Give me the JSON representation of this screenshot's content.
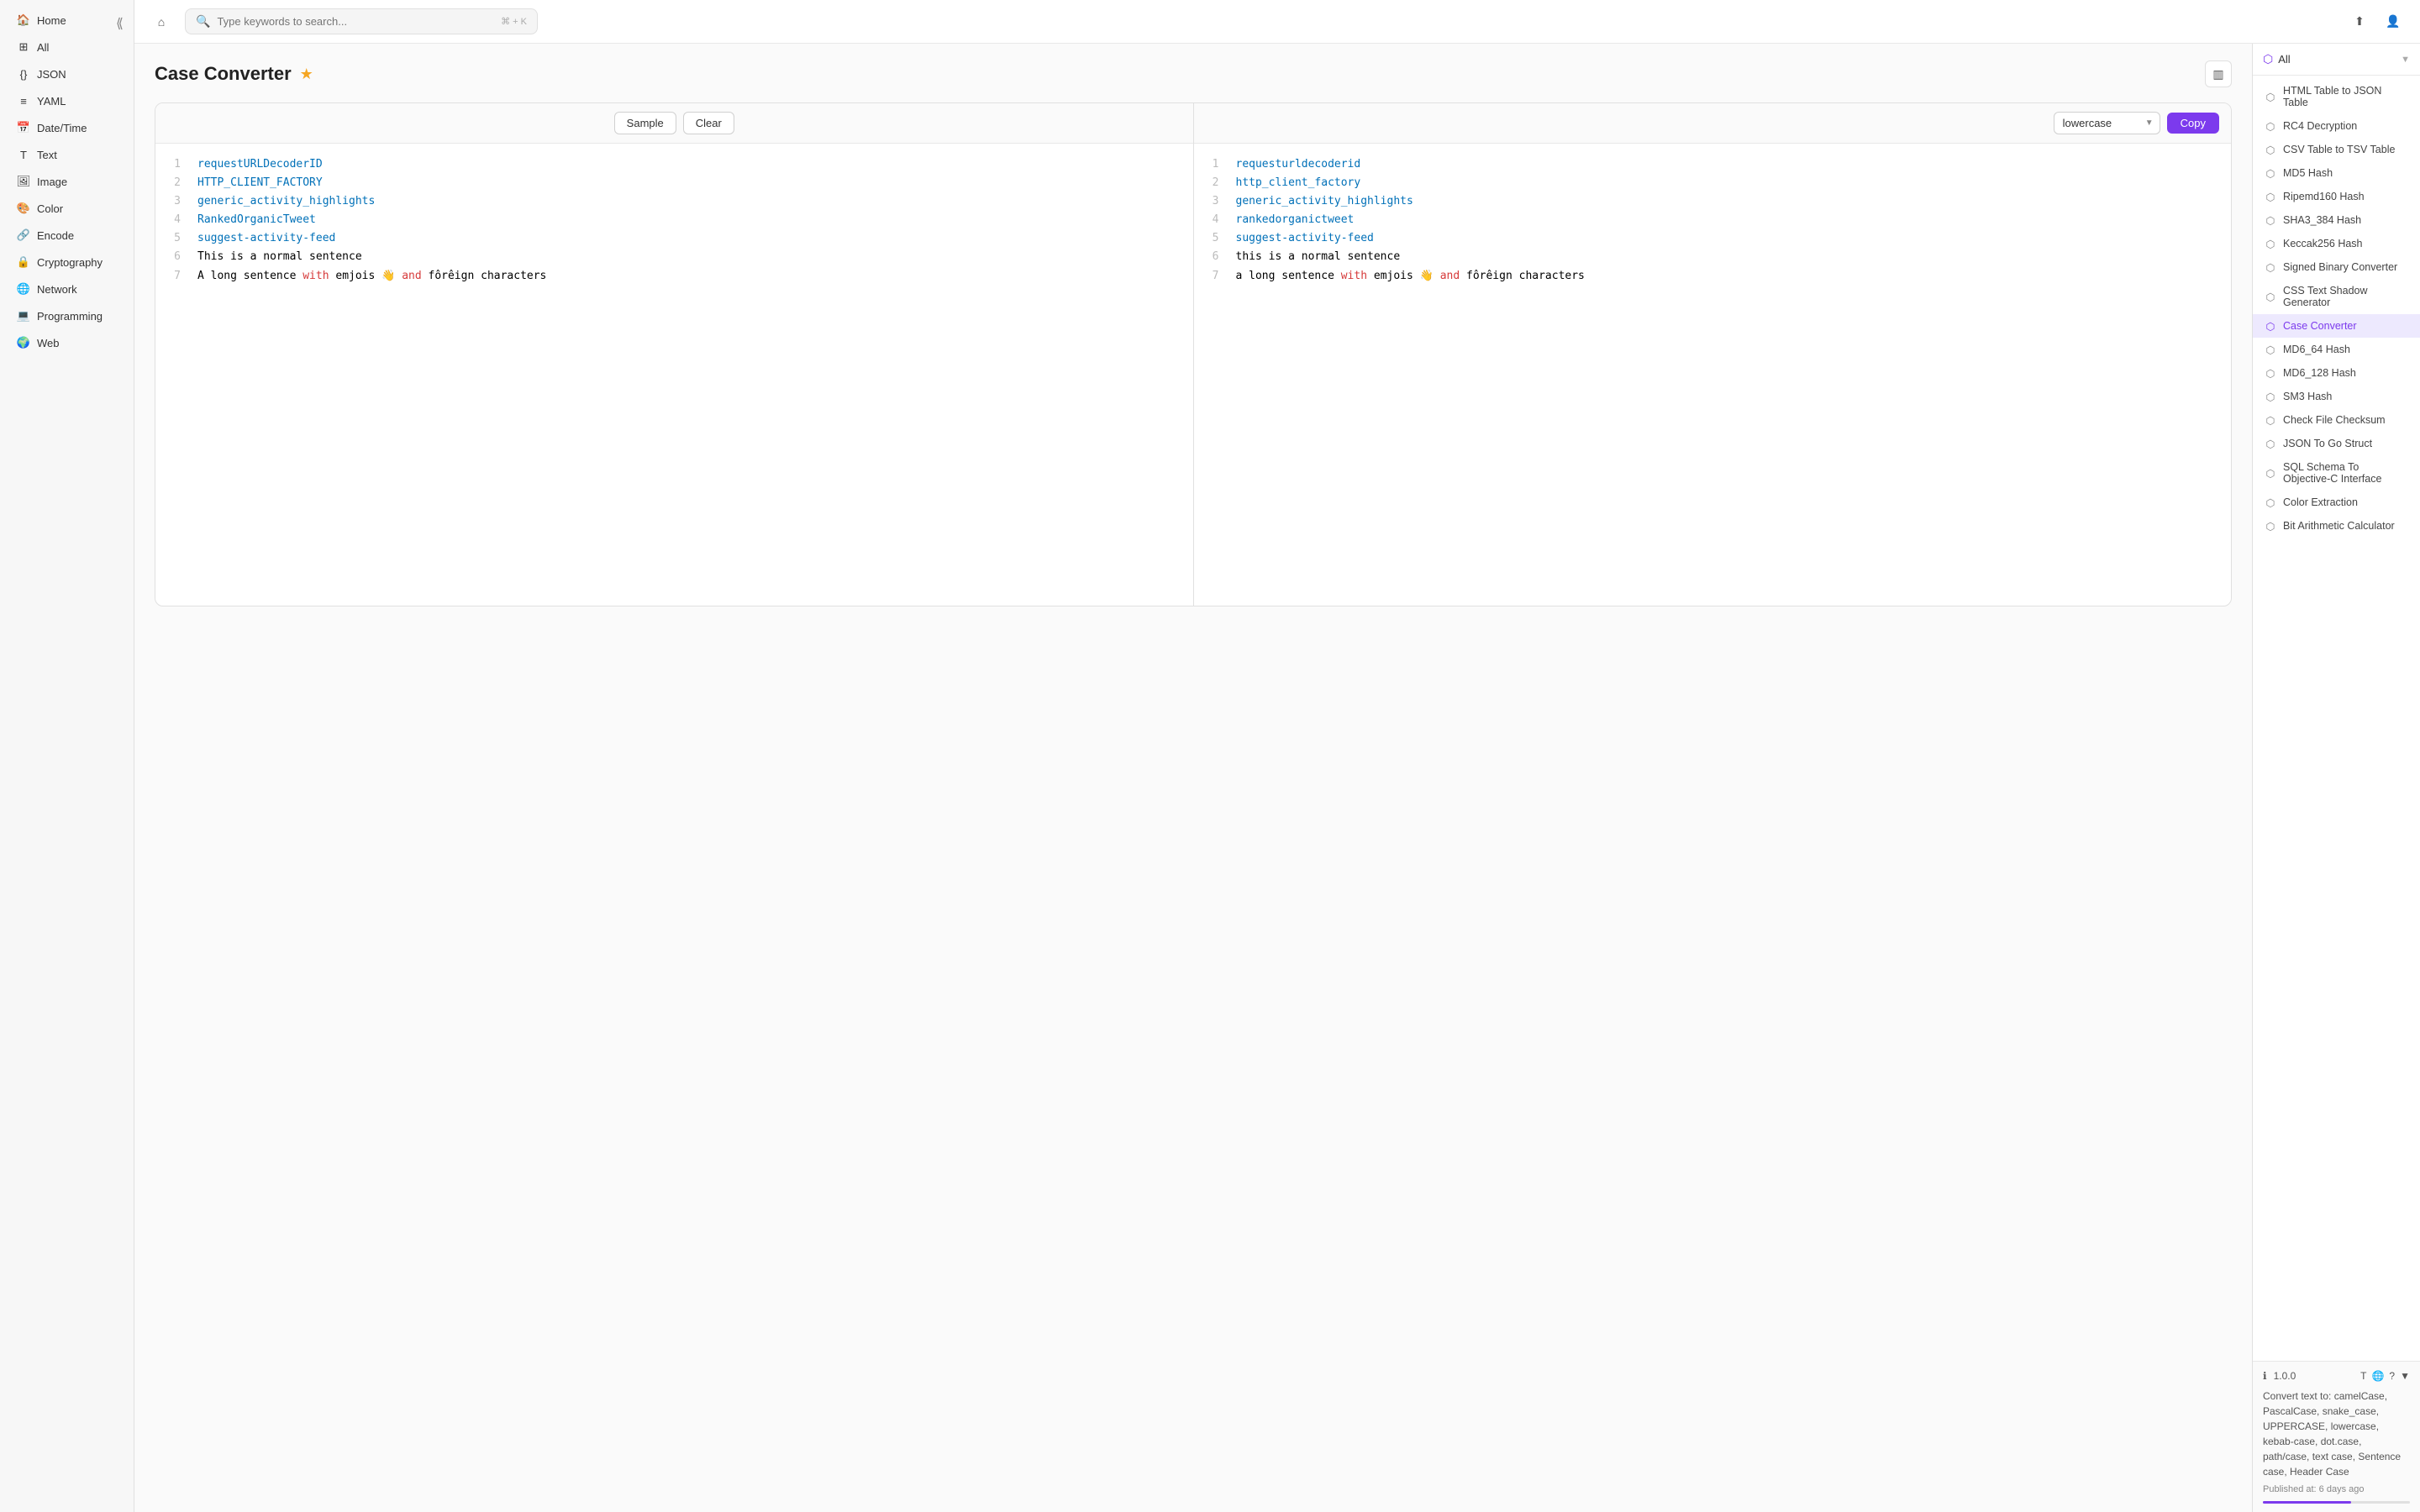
{
  "app": {
    "title": "Case Converter"
  },
  "topbar": {
    "search_placeholder": "Type keywords to search...",
    "shortcut": "⌘ + K"
  },
  "sidebar": {
    "items": [
      {
        "id": "home",
        "label": "Home",
        "icon": "🏠"
      },
      {
        "id": "all",
        "label": "All",
        "icon": "⊞"
      },
      {
        "id": "json",
        "label": "JSON",
        "icon": "{}"
      },
      {
        "id": "yaml",
        "label": "YAML",
        "icon": "≡"
      },
      {
        "id": "datetime",
        "label": "Date/Time",
        "icon": "📅"
      },
      {
        "id": "text",
        "label": "Text",
        "icon": "T"
      },
      {
        "id": "image",
        "label": "Image",
        "icon": "🖼"
      },
      {
        "id": "color",
        "label": "Color",
        "icon": "🎨"
      },
      {
        "id": "encode",
        "label": "Encode",
        "icon": "🔗"
      },
      {
        "id": "cryptography",
        "label": "Cryptography",
        "icon": "🔒"
      },
      {
        "id": "network",
        "label": "Network",
        "icon": "🌐"
      },
      {
        "id": "programming",
        "label": "Programming",
        "icon": "💻"
      },
      {
        "id": "web",
        "label": "Web",
        "icon": "🌍"
      }
    ]
  },
  "toolbar_left": {
    "sample_label": "Sample",
    "clear_label": "Clear"
  },
  "toolbar_right": {
    "case_options": [
      "lowercase",
      "UPPERCASE",
      "camelCase",
      "PascalCase",
      "snake_case",
      "kebab-case",
      "dot.case",
      "path/case",
      "text case",
      "Sentence case",
      "Header Case"
    ],
    "selected_case": "lowercase",
    "copy_label": "Copy"
  },
  "input_lines": [
    {
      "num": 1,
      "text": "requestURLDecoderID",
      "tokens": [
        {
          "text": "requestURLDecoderID",
          "class": "token-blue"
        }
      ]
    },
    {
      "num": 2,
      "text": "HTTP_CLIENT_FACTORY",
      "tokens": [
        {
          "text": "HTTP_CLIENT_FACTORY",
          "class": "token-blue"
        }
      ]
    },
    {
      "num": 3,
      "text": "generic_activity_highlights",
      "tokens": [
        {
          "text": "generic_activity_highlights",
          "class": "token-blue"
        }
      ]
    },
    {
      "num": 4,
      "text": "RankedOrganicTweet",
      "tokens": [
        {
          "text": "RankedOrganicTweet",
          "class": "token-blue"
        }
      ]
    },
    {
      "num": 5,
      "text": "suggest-activity-feed",
      "tokens": [
        {
          "text": "suggest-activity-feed",
          "class": "token-blue"
        }
      ]
    },
    {
      "num": 6,
      "text": "This is a normal sentence",
      "tokens": [
        {
          "text": "This is a normal sentence",
          "class": ""
        }
      ]
    },
    {
      "num": 7,
      "text": "A long sentence with emjois 👋 and fôrêign characters",
      "tokens": [
        {
          "text": "A long sentence ",
          "class": ""
        },
        {
          "text": "with",
          "class": "token-red"
        },
        {
          "text": " emjois 👋 ",
          "class": ""
        },
        {
          "text": "and",
          "class": "token-red"
        },
        {
          "text": " fôrêign characters",
          "class": ""
        }
      ]
    }
  ],
  "output_lines": [
    {
      "num": 1,
      "text": "requesturldecoderid",
      "tokens": [
        {
          "text": "requesturldecoderid",
          "class": "token-blue"
        }
      ]
    },
    {
      "num": 2,
      "text": "http_client_factory",
      "tokens": [
        {
          "text": "http_client_factory",
          "class": "token-blue"
        }
      ]
    },
    {
      "num": 3,
      "text": "generic_activity_highlights",
      "tokens": [
        {
          "text": "generic_activity_highlights",
          "class": "token-blue"
        }
      ]
    },
    {
      "num": 4,
      "text": "rankedorganictweet",
      "tokens": [
        {
          "text": "rankedorganictweet",
          "class": "token-blue"
        }
      ]
    },
    {
      "num": 5,
      "text": "suggest-activity-feed",
      "tokens": [
        {
          "text": "suggest-activity-feed",
          "class": "token-blue"
        }
      ]
    },
    {
      "num": 6,
      "text": "this is a normal sentence",
      "tokens": [
        {
          "text": "this is a normal sentence",
          "class": ""
        }
      ]
    },
    {
      "num": 7,
      "text": "a long sentence with emjois 👋 and fôrêign characters",
      "tokens": [
        {
          "text": "a long sentence ",
          "class": ""
        },
        {
          "text": "with",
          "class": "token-red"
        },
        {
          "text": " emjois 👋 ",
          "class": ""
        },
        {
          "text": "and",
          "class": "token-red"
        },
        {
          "text": " fôrêign characters",
          "class": ""
        }
      ]
    }
  ],
  "right_sidebar": {
    "filter_label": "All",
    "items": [
      {
        "label": "HTML Table to JSON Table",
        "active": false
      },
      {
        "label": "RC4 Decryption",
        "active": false
      },
      {
        "label": "CSV Table to TSV Table",
        "active": false
      },
      {
        "label": "MD5 Hash",
        "active": false
      },
      {
        "label": "Ripemd160 Hash",
        "active": false
      },
      {
        "label": "SHA3_384 Hash",
        "active": false
      },
      {
        "label": "Keccak256 Hash",
        "active": false
      },
      {
        "label": "Signed Binary Converter",
        "active": false
      },
      {
        "label": "CSS Text Shadow Generator",
        "active": false
      },
      {
        "label": "Case Converter",
        "active": true
      },
      {
        "label": "MD6_64 Hash",
        "active": false
      },
      {
        "label": "MD6_128 Hash",
        "active": false
      },
      {
        "label": "SM3 Hash",
        "active": false
      },
      {
        "label": "Check File Checksum",
        "active": false
      },
      {
        "label": "JSON To Go Struct",
        "active": false
      },
      {
        "label": "SQL Schema To Objective-C Interface",
        "active": false
      },
      {
        "label": "Color Extraction",
        "active": false
      },
      {
        "label": "Bit Arithmetic Calculator",
        "active": false
      }
    ]
  },
  "bottom_info": {
    "version": "1.0.0",
    "description": "Convert text to: camelCase, PascalCase, snake_case, UPPERCASE, lowercase, kebab-case, dot.case, path/case, text case, Sentence case, Header Case",
    "published": "Published at: 6 days ago"
  }
}
